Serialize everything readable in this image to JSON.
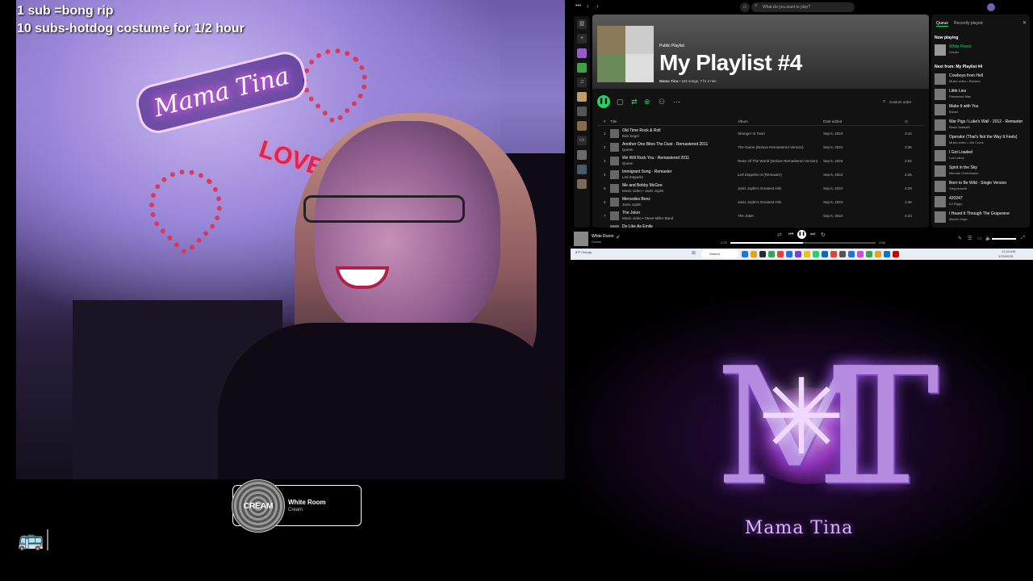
{
  "overlay": {
    "line1": "1 sub   =bong rip",
    "line2": "10 subs-hotdog costume for 1/2 hour"
  },
  "webcam": {
    "neon_sign": "Mama Tina",
    "love_sign": "LOVE"
  },
  "now_playing_widget": {
    "title": "White Room",
    "artist": "Cream",
    "art_text": "CREAM"
  },
  "spotify": {
    "search_placeholder": "What do you want to play?",
    "playlist": {
      "label": "Public Playlist",
      "title": "My Playlist #4",
      "owner": "Mama Tina",
      "meta": "• 104 songs, 7 hr 2 min"
    },
    "sort_label": "Custom order",
    "columns": {
      "num": "#",
      "title": "Title",
      "album": "Album",
      "date": "Date added",
      "duration": "◷"
    },
    "tracks": [
      {
        "num": "1",
        "title": "Old Time Rock & Roll",
        "artist": "Bob Seger",
        "album": "Stranger In Town",
        "date": "Sep 6, 2024",
        "duration": "3:14"
      },
      {
        "num": "2",
        "title": "Another One Bites The Dust - Remastered 2011",
        "artist": "Queen",
        "album": "The Game (Deluxe Remastered Version)",
        "date": "Sep 6, 2024",
        "duration": "3:35"
      },
      {
        "num": "3",
        "title": "We Will Rock You - Remastered 2011",
        "artist": "Queen",
        "album": "News Of The World (Deluxe Remastered Version)",
        "date": "Sep 6, 2024",
        "duration": "2:02"
      },
      {
        "num": "4",
        "title": "Immigrant Song - Remaster",
        "artist": "Led Zeppelin",
        "album": "Led Zeppelin III (Remaster)",
        "date": "Sep 6, 2024",
        "duration": "2:26"
      },
      {
        "num": "5",
        "title": "Me and Bobby McGee",
        "artist": "Music video • Janis Joplin",
        "album": "Janis Joplin's Greatest Hits",
        "date": "Sep 6, 2024",
        "duration": "4:29"
      },
      {
        "num": "6",
        "title": "Mercedes Benz",
        "artist": "Janis Joplin",
        "album": "Janis Joplin's Greatest Hits",
        "date": "Sep 6, 2024",
        "duration": "1:46"
      },
      {
        "num": "7",
        "title": "The Joker",
        "artist": "Music video • Steve Miller Band",
        "album": "The Joker",
        "date": "Sep 6, 2024",
        "duration": "4:23"
      },
      {
        "num": "8",
        "title": "Do Like As Emile",
        "artist": "",
        "album": "",
        "date": "",
        "duration": ""
      }
    ],
    "queue": {
      "tab_queue": "Queue",
      "tab_recent": "Recently played",
      "now_playing_label": "Now playing",
      "now_playing": {
        "title": "White Room",
        "artist": "Cream"
      },
      "next_from_label": "Next from: My Playlist #4",
      "items": [
        {
          "title": "Cowboys from Hell",
          "artist": "Music video • Pantera"
        },
        {
          "title": "Little Lies",
          "artist": "Fleetwood Mac"
        },
        {
          "title": "Make It with You",
          "artist": "Bread"
        },
        {
          "title": "War Pigs / Luke's Wall - 2012 - Remaster",
          "artist": "Black Sabbath"
        },
        {
          "title": "Operator (That's Not the Way It Feels)",
          "artist": "Music video • Jim Croce"
        },
        {
          "title": "I Got Loaded",
          "artist": "Los Lobos"
        },
        {
          "title": "Spirit in the Sky",
          "artist": "Norman Greenbaum"
        },
        {
          "title": "Born to Be Wild - Single Version",
          "artist": "Steppenwolf"
        },
        {
          "title": "420247",
          "artist": "DJ Rippy"
        },
        {
          "title": "I Heard It Through The Grapevine",
          "artist": "Marvin Gaye"
        }
      ]
    },
    "player": {
      "title": "White Room",
      "artist": "Cream",
      "elapsed": "2:29",
      "total": "4:58",
      "progress": 0.5
    },
    "taskbar": {
      "weather": "8°F Cloudy",
      "search": "Search",
      "time": "12:44 AM",
      "date": "1/23/2025"
    }
  },
  "logo": {
    "monogram": "MT",
    "name": "Mama Tina"
  },
  "colors": {
    "spotify_green": "#1ed760",
    "logo_purple": "#b58be0"
  },
  "icons": {
    "bus": "bus-icon"
  }
}
